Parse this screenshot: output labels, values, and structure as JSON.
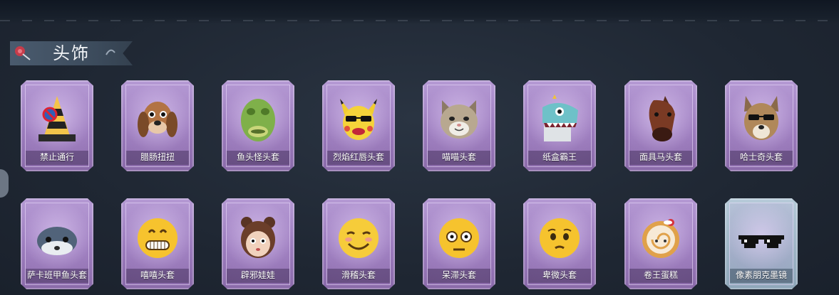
{
  "section": {
    "title": "头饰"
  },
  "items": [
    {
      "label": "禁止通行",
      "icon": "traffic-cone-icon"
    },
    {
      "label": "腊肠扭扭",
      "icon": "dachshund-mask-icon"
    },
    {
      "label": "鱼头怪头套",
      "icon": "fish-head-mask-icon"
    },
    {
      "label": "烈焰红唇头套",
      "icon": "pikachu-sunglasses-mask-icon"
    },
    {
      "label": "喵喵头套",
      "icon": "cat-mask-icon"
    },
    {
      "label": "纸盒霸王",
      "icon": "cardboard-dinosaur-mask-icon"
    },
    {
      "label": "面具马头套",
      "icon": "horse-mask-icon"
    },
    {
      "label": "哈士奇头套",
      "icon": "husky-sunglasses-mask-icon"
    },
    {
      "label": "萨卡班甲鱼头套",
      "icon": "sacabambaspis-mask-icon"
    },
    {
      "label": "嘻嘻头套",
      "icon": "grinning-emoji-mask-icon"
    },
    {
      "label": "辟邪娃娃",
      "icon": "doll-mask-icon"
    },
    {
      "label": "滑稽头套",
      "icon": "smirk-emoji-mask-icon"
    },
    {
      "label": "呆滞头套",
      "icon": "dazed-emoji-mask-icon"
    },
    {
      "label": "卑微头套",
      "icon": "pleading-emoji-mask-icon"
    },
    {
      "label": "卷王蛋糕",
      "icon": "roll-cake-icon"
    },
    {
      "label": "像素朋克墨镜",
      "icon": "pixel-sunglasses-icon"
    }
  ],
  "colors": {
    "card_purple": "#9b7bbd",
    "card_blue": "#9fb5c6",
    "banner": "#4a5b6e",
    "background": "#1f2733"
  }
}
